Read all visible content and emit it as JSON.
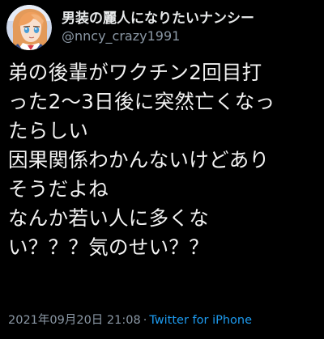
{
  "author": {
    "display_name": "男装の麗人になりたいナンシー",
    "handle": "@nncy_crazy1991",
    "avatar_icon": "anime-character-avatar"
  },
  "tweet": {
    "lines": [
      "弟の後輩がワクチン2回目打",
      "った2〜3日後に突然亡くなっ",
      "たらしい",
      "因果関係わかんないけどあり",
      "そうだよね",
      "なんか若い人に多くな",
      "い？？？気のせい？？"
    ]
  },
  "meta": {
    "timestamp": "2021年09月20日 21:08",
    "separator": "·",
    "client": "Twitter for iPhone"
  },
  "colors": {
    "background": "#000000",
    "text": "#e7e9ea",
    "secondary": "#8b98a5",
    "link": "#1d9bf0"
  }
}
